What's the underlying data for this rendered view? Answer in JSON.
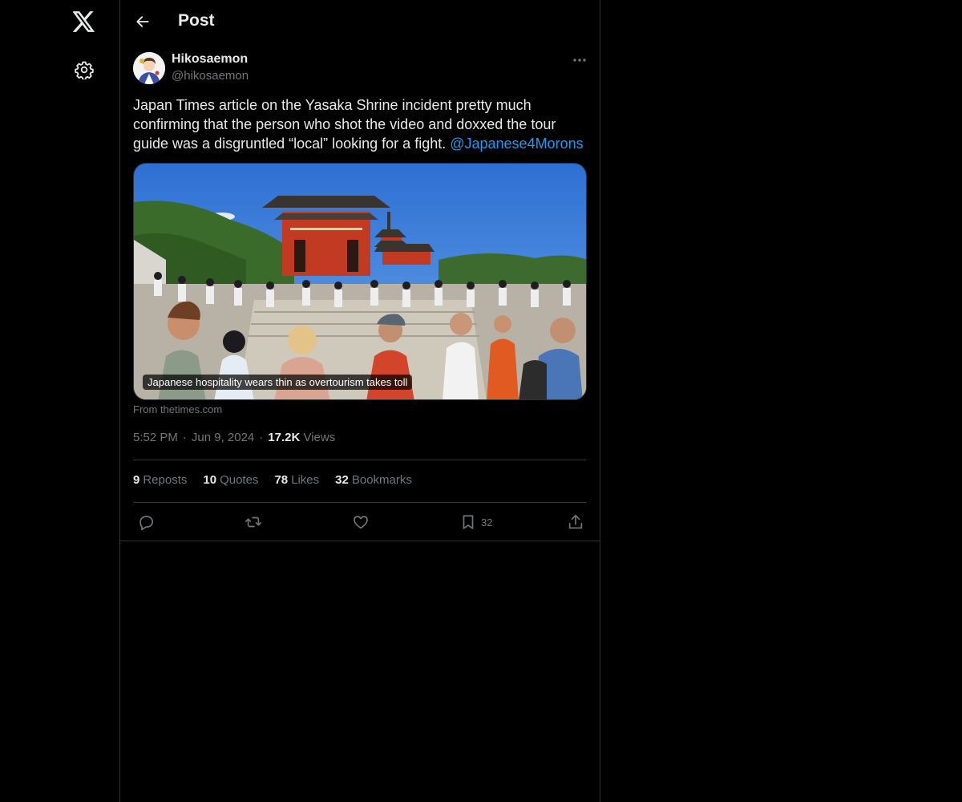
{
  "nav": {
    "logo_icon": "x-logo-icon",
    "settings_icon": "gear-icon"
  },
  "header": {
    "title": "Post",
    "back_icon": "arrow-left-icon"
  },
  "post": {
    "author_name": "Hikosaemon",
    "author_handle": "@hikosaemon",
    "text": "Japan Times article on the Yasaka Shrine incident pretty much confirming that the person who shot the video and doxxed the tour guide was a disgruntled “local” looking for a fight. ",
    "mention": "@Japanese4Morons",
    "card": {
      "caption": "Japanese hospitality wears thin as overtourism takes toll",
      "source": "From thetimes.com"
    },
    "time": "5:52 PM",
    "date": "Jun 9, 2024",
    "views_count": "17.2K",
    "views_label": "Views",
    "stats": [
      {
        "count": "9",
        "label": "Reposts"
      },
      {
        "count": "10",
        "label": "Quotes"
      },
      {
        "count": "78",
        "label": "Likes"
      },
      {
        "count": "32",
        "label": "Bookmarks"
      }
    ],
    "actions": {
      "reply_icon": "reply-icon",
      "repost_icon": "repost-icon",
      "like_icon": "heart-icon",
      "bookmark_icon": "bookmark-icon",
      "bookmark_count": "32",
      "share_icon": "share-icon"
    }
  },
  "colors": {
    "background": "#000000",
    "text": "#e7e9ea",
    "muted": "#71767b",
    "accent": "#1d9bf0",
    "border": "#2f3336"
  }
}
